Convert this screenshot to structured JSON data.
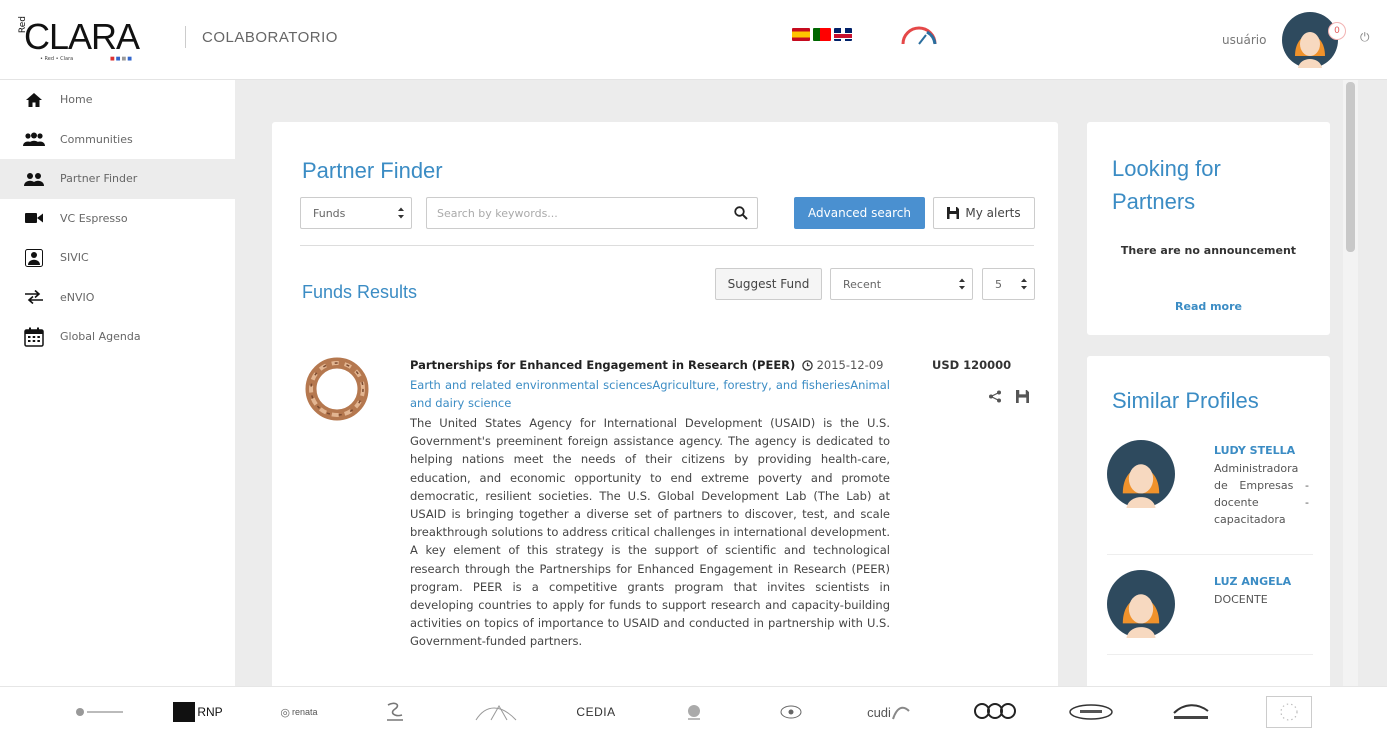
{
  "header": {
    "logo_text": "CLARA",
    "logo_prefix": "Red",
    "logo_subtitle": "• Red • Clara",
    "app_name": "COLABORATORIO",
    "languages": [
      "es",
      "pt",
      "en"
    ],
    "username": "usuário",
    "notifications": "0"
  },
  "sidebar": {
    "items": [
      {
        "label": "Home",
        "icon": "home-icon"
      },
      {
        "label": "Communities",
        "icon": "communities-icon"
      },
      {
        "label": "Partner Finder",
        "icon": "partner-finder-icon",
        "active": true
      },
      {
        "label": "VC Espresso",
        "icon": "video-camera-icon"
      },
      {
        "label": "SIVIC",
        "icon": "sivic-icon"
      },
      {
        "label": "eNVIO",
        "icon": "transfer-icon"
      },
      {
        "label": "Global Agenda",
        "icon": "calendar-icon"
      }
    ]
  },
  "main": {
    "title": "Partner Finder",
    "type_select": "Funds",
    "search_placeholder": "Search by keywords...",
    "advanced_search": "Advanced search",
    "my_alerts": "My alerts",
    "results_title": "Funds Results",
    "suggest_fund": "Suggest Fund",
    "sort_select": "Recent",
    "page_size_select": "5",
    "fund": {
      "title": "Partnerships for Enhanced Engagement in Research (PEER)",
      "date": "2015-12-09",
      "categories": "Earth and related environmental sciencesAgriculture, forestry, and fisheriesAnimal and dairy science",
      "description": "The United States Agency for International Development (USAID) is the U.S. Government's preeminent foreign assistance agency. The agency is dedicated to helping nations meet the needs of their citizens by providing health-care, education, and economic opportunity to end extreme poverty and promote democratic, resilient societies. The U.S. Global Development Lab (The Lab) at USAID is bringing together a diverse set of partners to discover, test, and scale breakthrough solutions to address critical challenges in international development. A key element of this strategy is the support of scientific and technological research through the Partnerships for Enhanced Engagement in Research (PEER) program. PEER is a competitive grants program that invites scientists in developing countries to apply for funds to support research and capacity-building activities on topics of importance to USAID and conducted in partnership with U.S. Government-funded partners.",
      "amount": "USD 120000"
    }
  },
  "looking": {
    "title_line1": "Looking for",
    "title_line2": "Partners",
    "empty_text": "There are no announcement",
    "read_more": "Read more"
  },
  "similar": {
    "title": "Similar Profiles",
    "profiles": [
      {
        "name": "LUDY STELLA",
        "role": "Administradora de Empresas - docente - capacitadora"
      },
      {
        "name": "LUZ ANGELA",
        "role": "DOCENTE"
      }
    ]
  },
  "footer": {
    "partners": [
      "RNP",
      "renata",
      "CEDIA",
      "cudi"
    ]
  },
  "colors": {
    "accent": "#3b8cc4",
    "button": "#4a90d0",
    "avatar_ring": "#2e4a5e",
    "avatar_hair": "#f0922b"
  }
}
